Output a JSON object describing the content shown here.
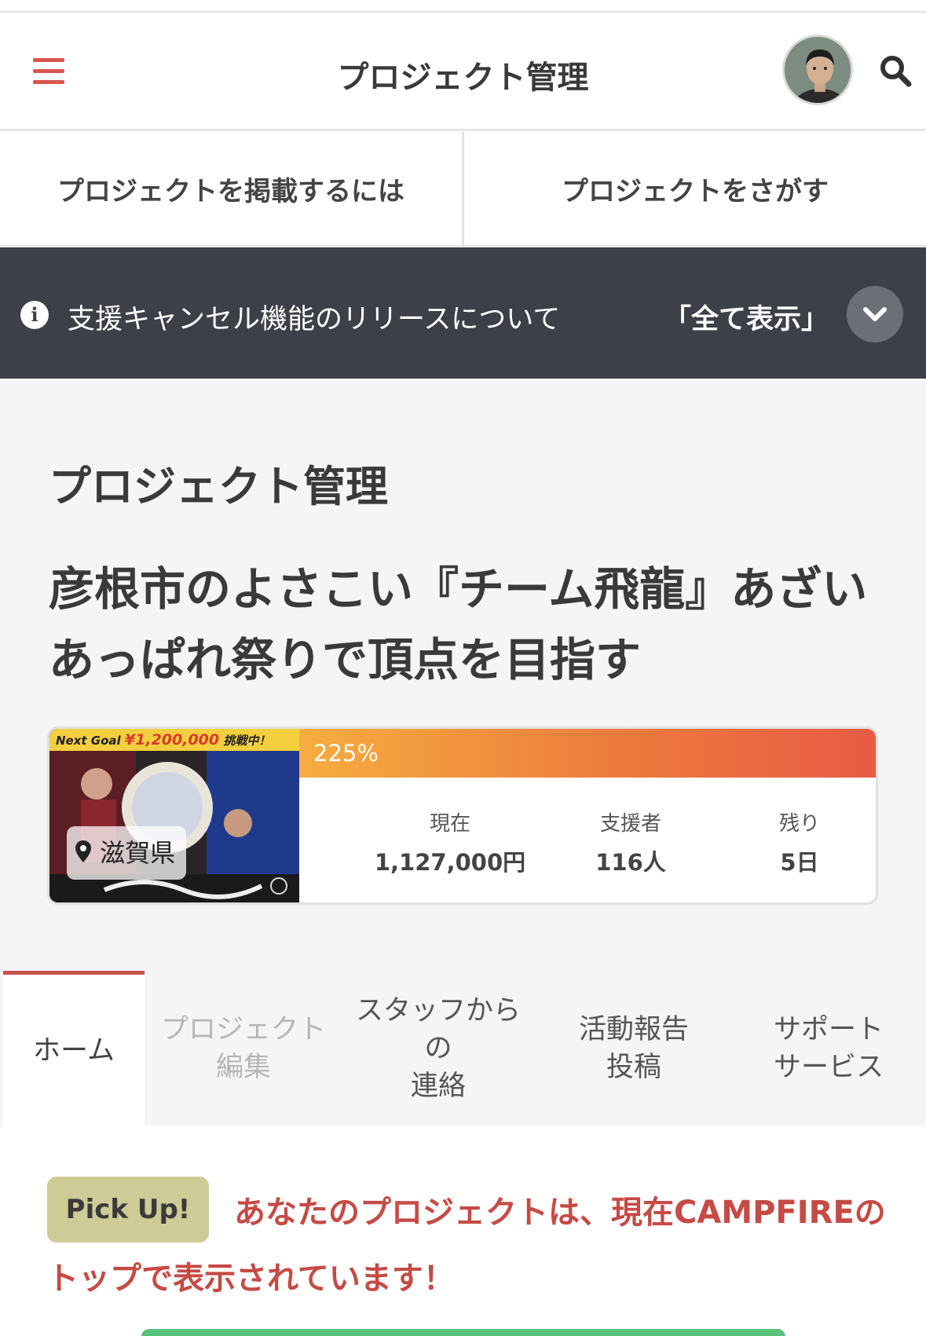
{
  "header": {
    "title": "プロジェクト管理"
  },
  "nav": {
    "items": [
      {
        "label": "プロジェクトを掲載するには"
      },
      {
        "label": "プロジェクトをさがす"
      }
    ]
  },
  "notice": {
    "text": "支援キャンセル機能のリリースについて",
    "show_all": "「全て表示」"
  },
  "page": {
    "heading": "プロジェクト管理",
    "project_title": "彦根市のよさこい『チーム飛龍』あざいあっぱれ祭りで頂点を目指す"
  },
  "card": {
    "next_goal_prefix": "Next Goal",
    "next_goal_amount": "¥1,200,000",
    "next_goal_suffix": "挑戦中！",
    "location": "滋賀県",
    "progress_label": "225%",
    "progress_value": 1.0,
    "stats": [
      {
        "label": "現在",
        "value": "1,127,000円"
      },
      {
        "label": "支援者",
        "value": "116人"
      },
      {
        "label": "残り",
        "value": "5日"
      }
    ]
  },
  "tabs": {
    "home": "ホーム",
    "edit_line1": "プロジェクト",
    "edit_line2": "編集",
    "contact_line1": "スタッフから",
    "contact_line2": "の",
    "contact_line3": "連絡",
    "report_line1": "活動報告",
    "report_line2": "投稿",
    "support_line1": "サポート",
    "support_line2": "サービス"
  },
  "pickup": {
    "badge": "Pick Up!",
    "message": "あなたのプロジェクトは、現在CAMPFIREのトップで表示されています！"
  },
  "colors": {
    "accent": "#d9564e",
    "notice_bg": "#3d4049",
    "pickup_text": "#c64a45",
    "pickup_badge": "#cfcb97"
  },
  "icons": [
    "menu-icon",
    "search-icon",
    "info-icon",
    "chevron-down-icon",
    "location-pin-icon"
  ]
}
